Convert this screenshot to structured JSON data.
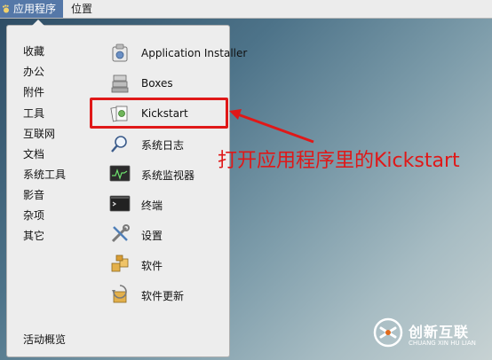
{
  "topbar": {
    "applications_label": "应用程序",
    "places_label": "位置"
  },
  "categories": [
    "收藏",
    "办公",
    "附件",
    "工具",
    "互联网",
    "文档",
    "系统工具",
    "影音",
    "杂项",
    "其它"
  ],
  "activities_label": "活动概览",
  "apps": [
    {
      "label": "Application Installer",
      "icon": "package-installer-icon"
    },
    {
      "label": "Boxes",
      "icon": "boxes-icon"
    },
    {
      "label": "Kickstart",
      "icon": "kickstart-icon"
    },
    {
      "label": "系统日志",
      "icon": "log-search-icon"
    },
    {
      "label": "系统监视器",
      "icon": "system-monitor-icon"
    },
    {
      "label": "终端",
      "icon": "terminal-icon"
    },
    {
      "label": "设置",
      "icon": "settings-tools-icon"
    },
    {
      "label": "软件",
      "icon": "software-icon"
    },
    {
      "label": "软件更新",
      "icon": "software-update-icon"
    }
  ],
  "annotation": {
    "text": "打开应用程序里的Kickstart",
    "color": "#e01818"
  },
  "watermark": {
    "name": "创新互联",
    "sub": "CHUANG XIN HU LIAN"
  },
  "colors": {
    "accent": "#5578a8",
    "highlight": "#e01818"
  }
}
